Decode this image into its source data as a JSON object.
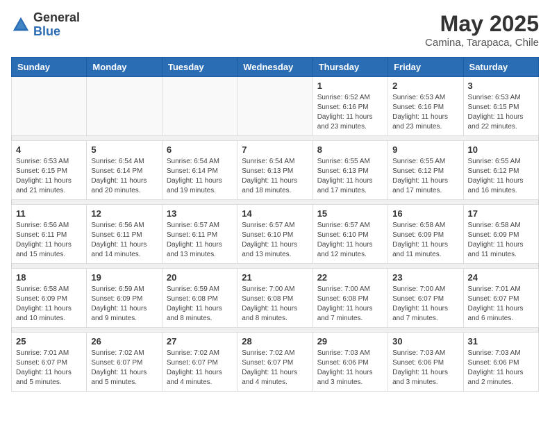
{
  "logo": {
    "general": "General",
    "blue": "Blue"
  },
  "title": "May 2025",
  "subtitle": "Camina, Tarapaca, Chile",
  "weekdays": [
    "Sunday",
    "Monday",
    "Tuesday",
    "Wednesday",
    "Thursday",
    "Friday",
    "Saturday"
  ],
  "weeks": [
    [
      {
        "day": "",
        "info": ""
      },
      {
        "day": "",
        "info": ""
      },
      {
        "day": "",
        "info": ""
      },
      {
        "day": "",
        "info": ""
      },
      {
        "day": "1",
        "info": "Sunrise: 6:52 AM\nSunset: 6:16 PM\nDaylight: 11 hours\nand 23 minutes."
      },
      {
        "day": "2",
        "info": "Sunrise: 6:53 AM\nSunset: 6:16 PM\nDaylight: 11 hours\nand 23 minutes."
      },
      {
        "day": "3",
        "info": "Sunrise: 6:53 AM\nSunset: 6:15 PM\nDaylight: 11 hours\nand 22 minutes."
      }
    ],
    [
      {
        "day": "4",
        "info": "Sunrise: 6:53 AM\nSunset: 6:15 PM\nDaylight: 11 hours\nand 21 minutes."
      },
      {
        "day": "5",
        "info": "Sunrise: 6:54 AM\nSunset: 6:14 PM\nDaylight: 11 hours\nand 20 minutes."
      },
      {
        "day": "6",
        "info": "Sunrise: 6:54 AM\nSunset: 6:14 PM\nDaylight: 11 hours\nand 19 minutes."
      },
      {
        "day": "7",
        "info": "Sunrise: 6:54 AM\nSunset: 6:13 PM\nDaylight: 11 hours\nand 18 minutes."
      },
      {
        "day": "8",
        "info": "Sunrise: 6:55 AM\nSunset: 6:13 PM\nDaylight: 11 hours\nand 17 minutes."
      },
      {
        "day": "9",
        "info": "Sunrise: 6:55 AM\nSunset: 6:12 PM\nDaylight: 11 hours\nand 17 minutes."
      },
      {
        "day": "10",
        "info": "Sunrise: 6:55 AM\nSunset: 6:12 PM\nDaylight: 11 hours\nand 16 minutes."
      }
    ],
    [
      {
        "day": "11",
        "info": "Sunrise: 6:56 AM\nSunset: 6:11 PM\nDaylight: 11 hours\nand 15 minutes."
      },
      {
        "day": "12",
        "info": "Sunrise: 6:56 AM\nSunset: 6:11 PM\nDaylight: 11 hours\nand 14 minutes."
      },
      {
        "day": "13",
        "info": "Sunrise: 6:57 AM\nSunset: 6:11 PM\nDaylight: 11 hours\nand 13 minutes."
      },
      {
        "day": "14",
        "info": "Sunrise: 6:57 AM\nSunset: 6:10 PM\nDaylight: 11 hours\nand 13 minutes."
      },
      {
        "day": "15",
        "info": "Sunrise: 6:57 AM\nSunset: 6:10 PM\nDaylight: 11 hours\nand 12 minutes."
      },
      {
        "day": "16",
        "info": "Sunrise: 6:58 AM\nSunset: 6:09 PM\nDaylight: 11 hours\nand 11 minutes."
      },
      {
        "day": "17",
        "info": "Sunrise: 6:58 AM\nSunset: 6:09 PM\nDaylight: 11 hours\nand 11 minutes."
      }
    ],
    [
      {
        "day": "18",
        "info": "Sunrise: 6:58 AM\nSunset: 6:09 PM\nDaylight: 11 hours\nand 10 minutes."
      },
      {
        "day": "19",
        "info": "Sunrise: 6:59 AM\nSunset: 6:09 PM\nDaylight: 11 hours\nand 9 minutes."
      },
      {
        "day": "20",
        "info": "Sunrise: 6:59 AM\nSunset: 6:08 PM\nDaylight: 11 hours\nand 8 minutes."
      },
      {
        "day": "21",
        "info": "Sunrise: 7:00 AM\nSunset: 6:08 PM\nDaylight: 11 hours\nand 8 minutes."
      },
      {
        "day": "22",
        "info": "Sunrise: 7:00 AM\nSunset: 6:08 PM\nDaylight: 11 hours\nand 7 minutes."
      },
      {
        "day": "23",
        "info": "Sunrise: 7:00 AM\nSunset: 6:07 PM\nDaylight: 11 hours\nand 7 minutes."
      },
      {
        "day": "24",
        "info": "Sunrise: 7:01 AM\nSunset: 6:07 PM\nDaylight: 11 hours\nand 6 minutes."
      }
    ],
    [
      {
        "day": "25",
        "info": "Sunrise: 7:01 AM\nSunset: 6:07 PM\nDaylight: 11 hours\nand 5 minutes."
      },
      {
        "day": "26",
        "info": "Sunrise: 7:02 AM\nSunset: 6:07 PM\nDaylight: 11 hours\nand 5 minutes."
      },
      {
        "day": "27",
        "info": "Sunrise: 7:02 AM\nSunset: 6:07 PM\nDaylight: 11 hours\nand 4 minutes."
      },
      {
        "day": "28",
        "info": "Sunrise: 7:02 AM\nSunset: 6:07 PM\nDaylight: 11 hours\nand 4 minutes."
      },
      {
        "day": "29",
        "info": "Sunrise: 7:03 AM\nSunset: 6:06 PM\nDaylight: 11 hours\nand 3 minutes."
      },
      {
        "day": "30",
        "info": "Sunrise: 7:03 AM\nSunset: 6:06 PM\nDaylight: 11 hours\nand 3 minutes."
      },
      {
        "day": "31",
        "info": "Sunrise: 7:03 AM\nSunset: 6:06 PM\nDaylight: 11 hours\nand 2 minutes."
      }
    ]
  ]
}
